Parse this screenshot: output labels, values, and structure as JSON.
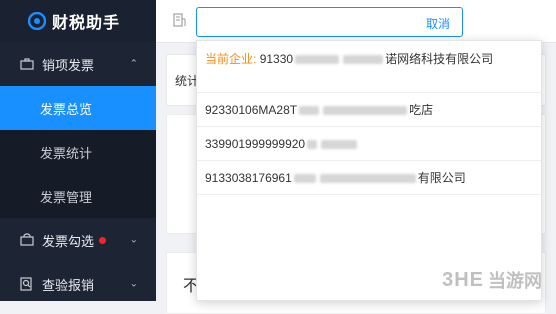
{
  "app": {
    "title": "财税助手"
  },
  "sidebar": {
    "groups": [
      {
        "label": "销项发票",
        "expanded": true,
        "children": [
          "发票总览",
          "发票统计",
          "发票管理"
        ],
        "active_child": 0
      },
      {
        "label": "发票勾选",
        "expanded": false,
        "has_badge": true
      },
      {
        "label": "查验报销",
        "expanded": false
      }
    ]
  },
  "search": {
    "value": "",
    "cancel_label": "取消"
  },
  "content": {
    "stats_label": "统计",
    "lower_label": "不"
  },
  "dropdown": {
    "current_label": "当前企业:",
    "current_prefix": "91330",
    "current_suffix": "诺网络科技有限公司",
    "items": [
      {
        "prefix": "92330106MA28T",
        "suffix": "吃店"
      },
      {
        "prefix": "339901999999920",
        "suffix": ""
      },
      {
        "prefix": "9133038176961",
        "suffix": "有限公司"
      }
    ]
  },
  "watermark": {
    "brand": "3HE",
    "text": "当游网"
  },
  "colors": {
    "accent": "#1890ff",
    "sidebar": "#1d2534",
    "current": "#fa8c16",
    "badge": "#f5222d"
  }
}
